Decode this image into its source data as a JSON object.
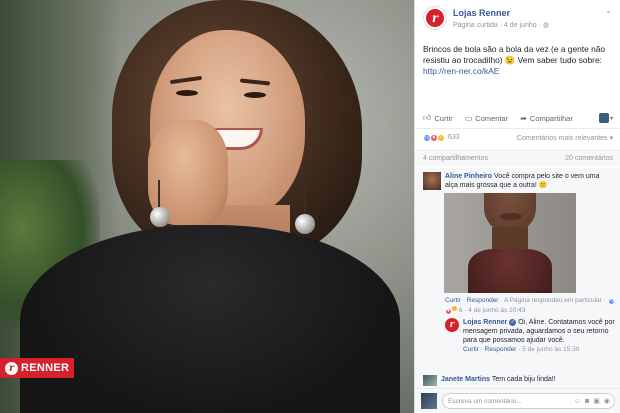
{
  "page": {
    "name": "Lojas Renner",
    "meta": "Página curtida · 4 de junho · ",
    "avatar_letter": "r"
  },
  "post": {
    "text": "Brincos de bola são a bola da vez (e a gente não resistiu ao trocadilho) 😉 Vem saber tudo sobre: ",
    "link": "http://ren-ner.co/kAE"
  },
  "actions": {
    "like": "Curtir",
    "comment": "Comentar",
    "share": "Compartilhar"
  },
  "reactions": {
    "count": "633",
    "order_label": "Comentários mais relevantes ▾"
  },
  "shares": {
    "shares_label": "4 compartilhamentos",
    "comments_label": "20 comentários"
  },
  "comments": [
    {
      "name": "Aline Pinheiro",
      "text": "Você compra pelo site o vem uma alça mais grossa que a outra! 😕",
      "reply_label": "Curtir",
      "answer_label": "Responder",
      "meta": " · A Página respondeu em particular · ",
      "reaction_count": "6",
      "time": " · 4 de junho às 20:43"
    },
    {
      "name": "Lojas Renner",
      "text": "Oi, Aline. Contatamos você por mensagem privada, aguardamos o seu retorno para que possamos ajudar você.",
      "reply_label": "Curtir",
      "answer_label": "Responder",
      "time": " · 5 de junho às 15:30"
    },
    {
      "name": "Janete Martins",
      "text": "Tem cada biju linda!!"
    }
  ],
  "write_comment": {
    "placeholder": "Escreva um comentário..."
  },
  "photo": {
    "badge_text": "RENNER"
  },
  "colors": {
    "brand_red": "#d6202c",
    "facebook_blue": "#365899"
  }
}
